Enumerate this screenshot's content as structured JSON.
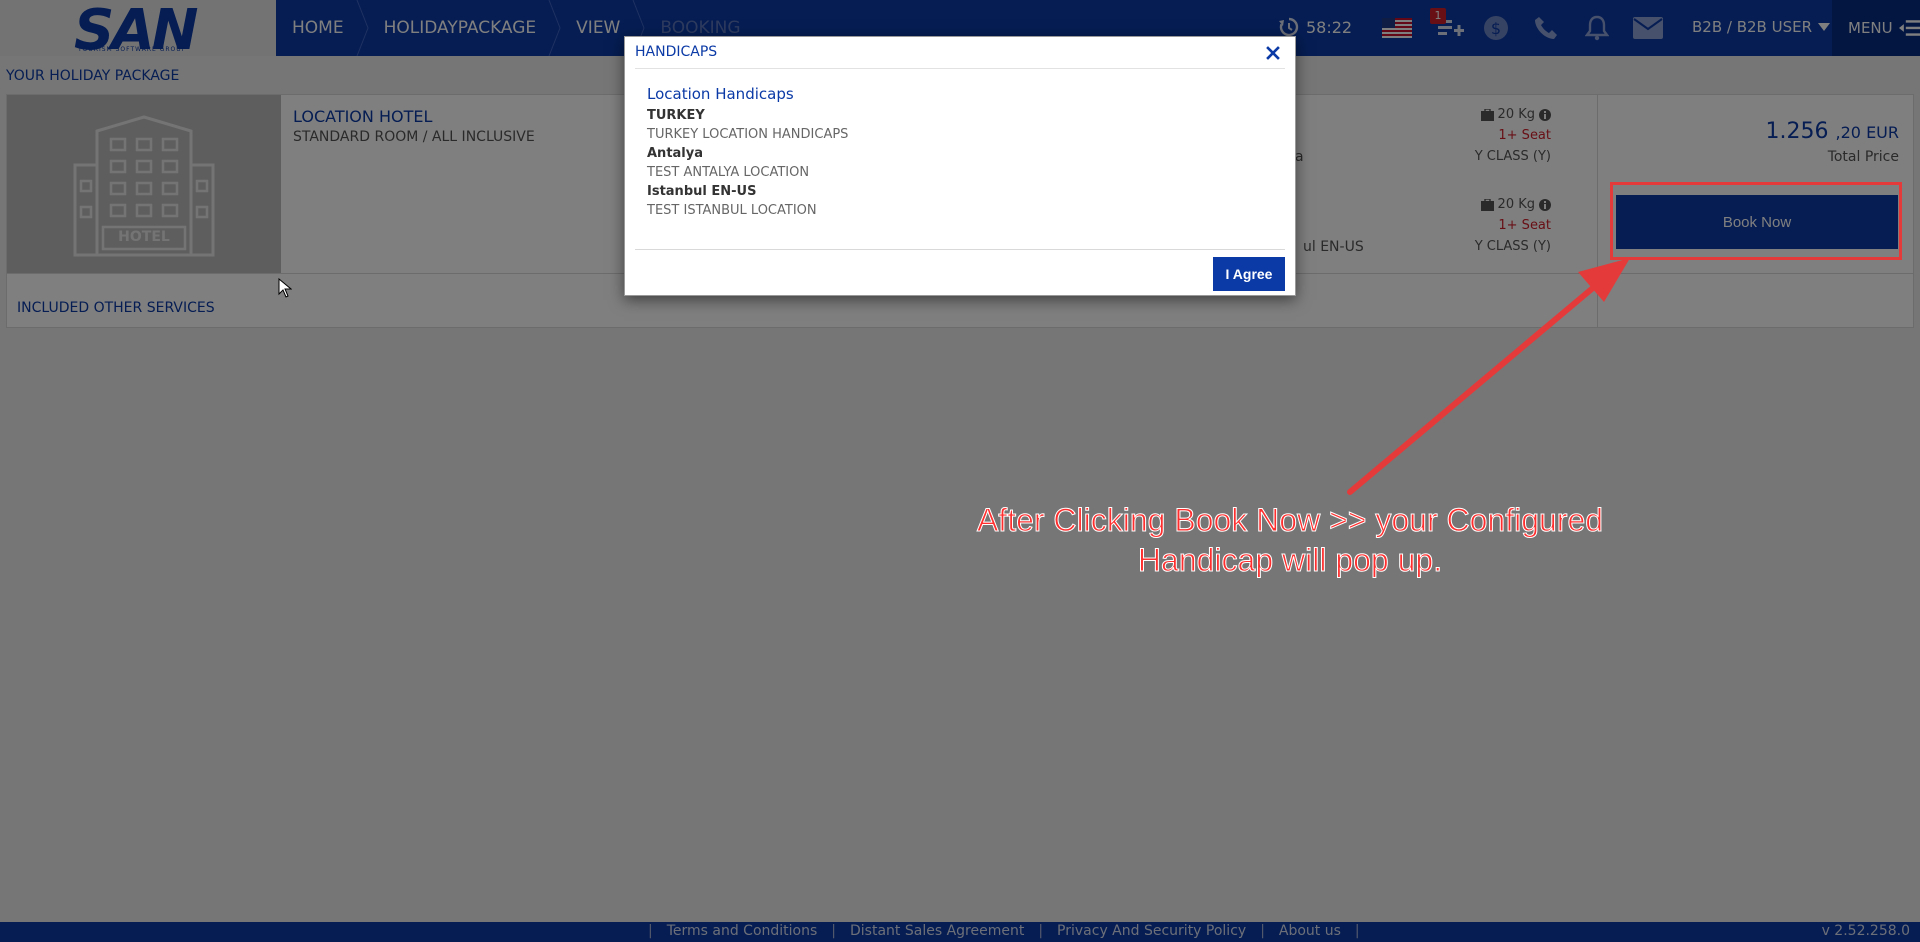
{
  "header": {
    "logo": "SAN",
    "logo_sub": "TOURISM SOFTWARE GROUP",
    "breadcrumbs": [
      {
        "label": "HOME",
        "disabled": false
      },
      {
        "label": "HOLIDAYPACKAGE",
        "disabled": false
      },
      {
        "label": "VIEW",
        "disabled": false
      },
      {
        "label": "BOOKING",
        "disabled": true
      }
    ],
    "timer": "58:22",
    "cart_badge": "1",
    "user_label": "B2B / B2B USER",
    "menu_label": "MENU",
    "icons": [
      "history-icon",
      "us-flag-icon",
      "cart-add-icon",
      "currency-icon",
      "phone-icon",
      "bell-icon",
      "mail-icon",
      "menu-list-icon"
    ]
  },
  "page": {
    "section_title": "YOUR HOLIDAY PACKAGE",
    "hotel": {
      "image_label": "HOTEL",
      "name": "LOCATION HOTEL",
      "room": "STANDARD ROOM / ALL INCLUSIVE"
    },
    "flights": [
      {
        "luggage": "20 Kg",
        "seat": "1+ Seat",
        "class": "Y CLASS (Y)",
        "partial_text": "a"
      },
      {
        "luggage": "20 Kg",
        "seat": "1+ Seat",
        "class": "Y CLASS (Y)",
        "partial_text": "ul EN-US"
      }
    ],
    "price": {
      "whole": "1.256",
      "fraction": ",20 EUR",
      "label": "Total Price"
    },
    "book_button": "Book Now",
    "included_services": "INCLUDED OTHER SERVICES"
  },
  "modal": {
    "title": "HANDICAPS",
    "heading": "Location Handicaps",
    "items": [
      {
        "name": "TURKEY",
        "text": "TURKEY LOCATION HANDICAPS"
      },
      {
        "name": "Antalya",
        "text": "TEST ANTALYA LOCATION"
      },
      {
        "name": "Istanbul EN-US",
        "text": "TEST ISTANBUL LOCATION"
      }
    ],
    "agree_button": "I Agree"
  },
  "footer": {
    "links": [
      "Terms and Conditions",
      "Distant Sales Agreement",
      "Privacy And Security Policy",
      "About us"
    ],
    "version": "v 2.52.258.0"
  },
  "annotation": {
    "text_line1": "After Clicking Book Now >> your Configured",
    "text_line2": "Handicap will pop up."
  },
  "colors": {
    "brand_blue": "#0b3aa6",
    "seat_red": "#d11e2a",
    "annotation_red": "#ff2e2e"
  }
}
